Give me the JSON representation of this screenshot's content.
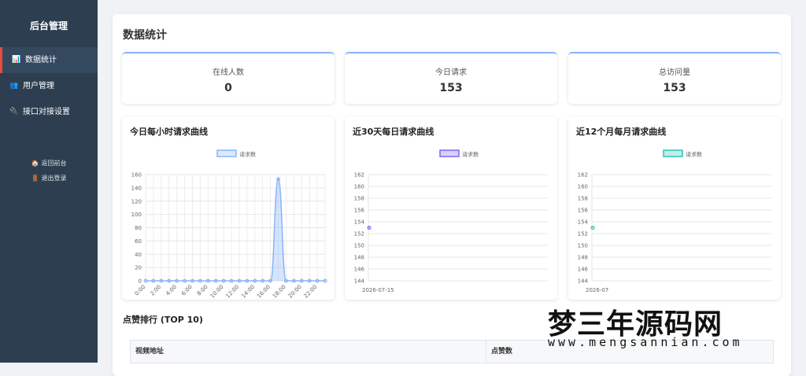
{
  "sidebar": {
    "brand": "后台管理",
    "items": [
      {
        "icon": "📊",
        "icon_name": "bar-chart-icon",
        "label": "数据统计",
        "active": true
      },
      {
        "icon": "👥",
        "icon_name": "users-icon",
        "label": "用户管理",
        "active": false
      },
      {
        "icon": "🔌",
        "icon_name": "plug-icon",
        "label": "接口对接设置",
        "active": false
      }
    ],
    "links": [
      {
        "icon": "🏠",
        "icon_name": "home-icon",
        "label": "返回前台"
      },
      {
        "icon": "🚪",
        "icon_name": "door-icon",
        "label": "退出登录"
      }
    ],
    "accent": "#e74c3c",
    "background": "#2c3e50"
  },
  "page": {
    "title": "数据统计"
  },
  "stats": [
    {
      "label": "在线人数",
      "value": "0"
    },
    {
      "label": "今日请求",
      "value": "153"
    },
    {
      "label": "总访问量",
      "value": "153"
    }
  ],
  "chart_data": [
    {
      "type": "line",
      "title": "今日每小时请求曲线",
      "color": "#8ab4f8",
      "fill": true,
      "x": [
        "0:00",
        "1:00",
        "2:00",
        "3:00",
        "4:00",
        "5:00",
        "6:00",
        "7:00",
        "8:00",
        "9:00",
        "10:00",
        "11:00",
        "12:00",
        "13:00",
        "14:00",
        "15:00",
        "16:00",
        "17:00",
        "18:00",
        "19:00",
        "20:00",
        "21:00",
        "22:00",
        "23:00"
      ],
      "tick_labels": [
        "0:00",
        "2:00",
        "4:00",
        "6:00",
        "8:00",
        "10:00",
        "12:00",
        "14:00",
        "16:00",
        "18:00",
        "20:00",
        "22:00"
      ],
      "series": [
        {
          "name": "请求数",
          "values": [
            0,
            0,
            0,
            0,
            0,
            0,
            0,
            0,
            0,
            0,
            0,
            0,
            0,
            0,
            0,
            0,
            0,
            153,
            0,
            0,
            0,
            0,
            0,
            0
          ]
        }
      ],
      "ylim": [
        0,
        160
      ],
      "yticks": [
        0,
        20,
        40,
        60,
        80,
        100,
        120,
        140,
        160
      ],
      "grid": true,
      "legend": "top"
    },
    {
      "type": "line",
      "title": "近30天每日请求曲线",
      "color": "#7b68ee",
      "fill": false,
      "x": [
        "2026-07-15"
      ],
      "tick_labels": [
        "2026-07-15"
      ],
      "series": [
        {
          "name": "请求数",
          "values": [
            153
          ]
        }
      ],
      "ylim": [
        144,
        162
      ],
      "yticks": [
        144,
        146,
        148,
        150,
        152,
        154,
        156,
        158,
        160,
        162
      ],
      "grid": true,
      "legend": "top"
    },
    {
      "type": "line",
      "title": "近12个月每月请求曲线",
      "color": "#2ec4b6",
      "fill": false,
      "x": [
        "2026-07"
      ],
      "tick_labels": [
        "2026-07"
      ],
      "series": [
        {
          "name": "请求数",
          "values": [
            153
          ]
        }
      ],
      "ylim": [
        144,
        162
      ],
      "yticks": [
        144,
        146,
        148,
        150,
        152,
        154,
        156,
        158,
        160,
        162
      ],
      "grid": true,
      "legend": "top"
    }
  ],
  "ranking": {
    "title": "点赞排行 (TOP 10)",
    "columns": [
      "视频地址",
      "点赞数"
    ]
  },
  "watermark": {
    "big": "梦三年源码网",
    "small": "www.mengsannian.com"
  }
}
